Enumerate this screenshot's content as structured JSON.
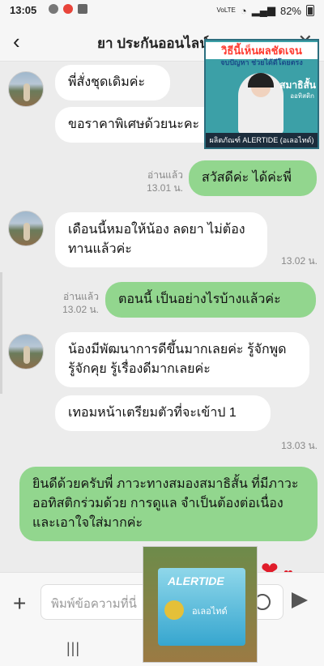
{
  "status": {
    "time": "13:05",
    "network": "VoLTE",
    "battery": "82%"
  },
  "header": {
    "title": "ยา ประกันออนไลน์"
  },
  "messages": [
    {
      "text": "พี่สั่งชุดเดิมค่ะ",
      "from": "received"
    },
    {
      "text": "ขอราคาพิเศษด้วยนะคะ",
      "from": "received"
    },
    {
      "text": "สวัสดีค่ะ ได้ค่ะพี่",
      "from": "sent",
      "read": "อ่านแล้ว",
      "time": "13.01 น."
    },
    {
      "text": "เดือนนี้หมอให้น้อง ลดยา ไม่ต้องทานแล้วค่ะ",
      "from": "received",
      "time": "13.02 น."
    },
    {
      "text": "ตอนนี้ เป็นอย่างไรบ้างแล้วค่ะ",
      "from": "sent",
      "read": "อ่านแล้ว",
      "time": "13.02 น."
    },
    {
      "text": "น้องมีพัฒนาการดีขึ้นมากเลยค่ะ รู้จักพูดรู้จักคุย รู้เรื่องดีมากเลยค่ะ",
      "from": "received"
    },
    {
      "text": "เทอมหน้าเตรียมตัวที่จะเข้าป 1",
      "from": "received",
      "time": "13.03 น."
    },
    {
      "text": "ยินดีด้วยครับพี่ ภาวะทางสมองสมาธิสั้น ที่มีภาวะออทิสติกร่วมด้วย การดูแล จำเป็นต้องต่อเนื่องและเอาใจใส่มากค่ะ",
      "from": "sent"
    }
  ],
  "input": {
    "placeholder": "พิมพ์ข้อความที่นี่"
  },
  "ad_top": {
    "headline": "วิธีนี้เห็นผลชัดเจน",
    "subline": "จบปัญหา ช่วยได้ดีโดยตรง",
    "tag1": "สมาธิสั้น",
    "tag2": "ออทิสติก",
    "footer": "ผลิตภัณฑ์ ALERTIDE (อเลอไทด์)"
  },
  "ad_bottom": {
    "brand": "ALERTIDE",
    "thai": "อเลอไทด์"
  },
  "colors": {
    "sent_bubble": "#92d68e",
    "received_bubble": "#ffffff",
    "chat_bg": "#ececec"
  }
}
